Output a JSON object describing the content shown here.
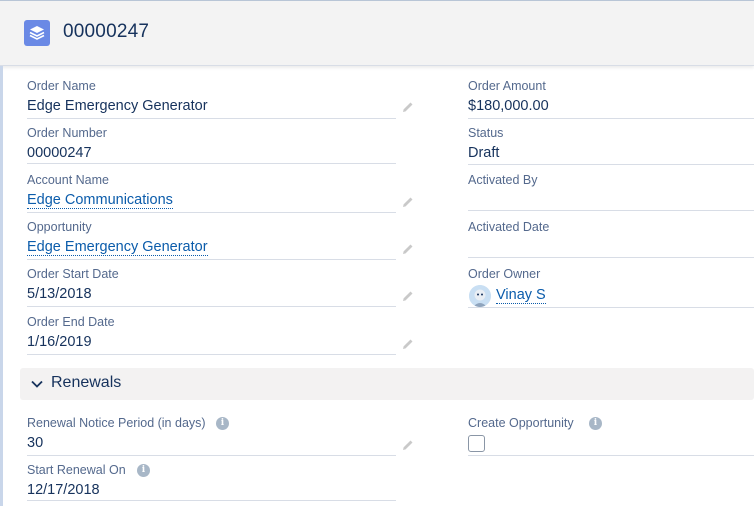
{
  "header": {
    "record_number": "00000247",
    "icon": "order-stack-icon"
  },
  "fields": {
    "order_name": {
      "label": "Order Name",
      "value": "Edge Emergency Generator"
    },
    "order_amount": {
      "label": "Order Amount",
      "value": "$180,000.00"
    },
    "order_number": {
      "label": "Order Number",
      "value": "00000247"
    },
    "status": {
      "label": "Status",
      "value": "Draft"
    },
    "account_name": {
      "label": "Account Name",
      "value": "Edge Communications"
    },
    "activated_by": {
      "label": "Activated By",
      "value": ""
    },
    "opportunity": {
      "label": "Opportunity",
      "value": "Edge Emergency Generator"
    },
    "activated_date": {
      "label": "Activated Date",
      "value": ""
    },
    "order_start_date": {
      "label": "Order Start Date",
      "value": "5/13/2018"
    },
    "order_owner": {
      "label": "Order Owner",
      "value": "Vinay S"
    },
    "order_end_date": {
      "label": "Order End Date",
      "value": "1/16/2019"
    }
  },
  "renewals": {
    "title": "Renewals",
    "renewal_notice_period": {
      "label": "Renewal Notice Period (in days)",
      "value": "30"
    },
    "create_opportunity": {
      "label": "Create Opportunity",
      "checked": false
    },
    "start_renewal_on": {
      "label": "Start Renewal On",
      "value": "12/17/2018"
    }
  },
  "colors": {
    "link": "#0b5cab",
    "label": "#54698d",
    "value": "#16325c",
    "header_icon_bg": "#6a89e5"
  }
}
